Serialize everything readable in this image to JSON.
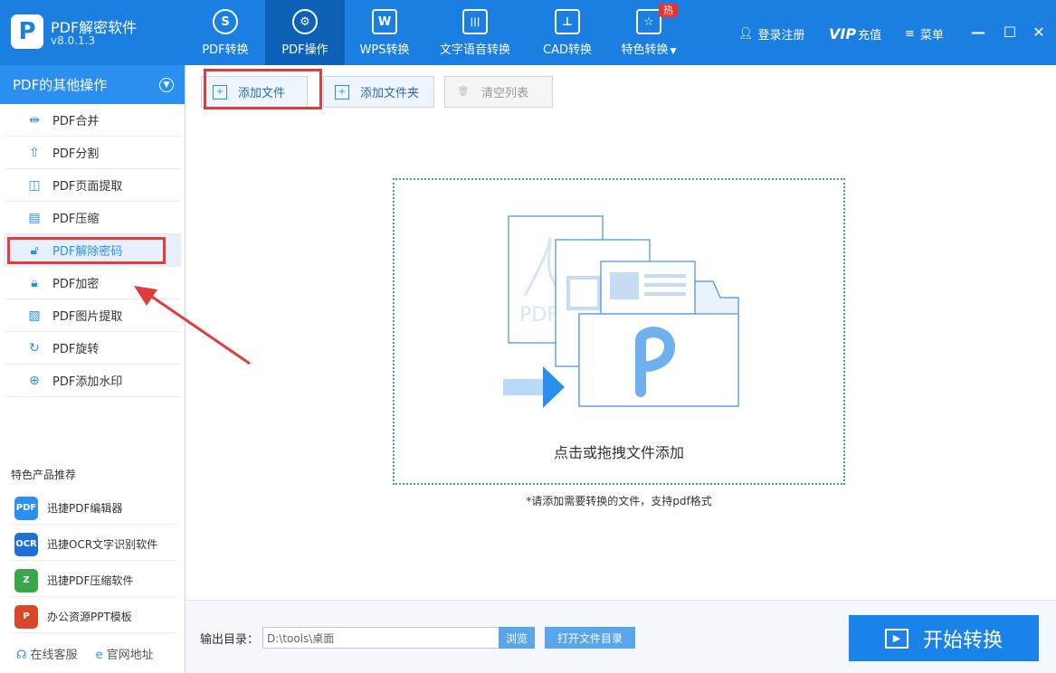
{
  "app": {
    "name": "PDF解密软件",
    "version": "v8.0.1.3",
    "logo_letter": "P"
  },
  "nav": [
    {
      "label": "PDF转换",
      "icon": "S",
      "active": false
    },
    {
      "label": "PDF操作",
      "icon": "⚙",
      "active": true
    },
    {
      "label": "WPS转换",
      "icon": "W",
      "active": false
    },
    {
      "label": "文字语音转换",
      "icon": "|||",
      "active": false
    },
    {
      "label": "CAD转换",
      "icon": "⊥",
      "active": false
    },
    {
      "label": "特色转换",
      "icon": "☆",
      "active": false,
      "badge": "热"
    }
  ],
  "topright": {
    "login": "登录注册",
    "vip": "VIP",
    "recharge": "充值",
    "menu": "菜单"
  },
  "sidebar": {
    "header": "PDF的其他操作",
    "items": [
      {
        "label": "PDF合并",
        "icon": "merge-icon"
      },
      {
        "label": "PDF分割",
        "icon": "split-icon"
      },
      {
        "label": "PDF页面提取",
        "icon": "extract-icon"
      },
      {
        "label": "PDF压缩",
        "icon": "compress-icon"
      },
      {
        "label": "PDF解除密码",
        "icon": "unlock-icon",
        "active": true
      },
      {
        "label": "PDF加密",
        "icon": "lock-icon"
      },
      {
        "label": "PDF图片提取",
        "icon": "image-icon"
      },
      {
        "label": "PDF旋转",
        "icon": "rotate-icon"
      },
      {
        "label": "PDF添加水印",
        "icon": "watermark-icon"
      }
    ],
    "section_title": "特色产品推荐",
    "promos": [
      {
        "label": "迅捷PDF编辑器",
        "badge": "PDF",
        "color": "#2b8ff0"
      },
      {
        "label": "迅捷OCR文字识别软件",
        "badge": "OCR",
        "color": "#1f6fd6"
      },
      {
        "label": "迅捷PDF压缩软件",
        "badge": "Z",
        "color": "#3aa54a"
      },
      {
        "label": "办公资源PPT模板",
        "badge": "P",
        "color": "#d9472b"
      }
    ],
    "footer": {
      "service": "在线客服",
      "website": "官网地址"
    }
  },
  "toolbar": {
    "add_file": "添加文件",
    "add_folder": "添加文件夹",
    "clear_list": "清空列表"
  },
  "dropzone": {
    "text": "点击或拖拽文件添加",
    "hint": "*请添加需要转换的文件，支持pdf格式",
    "doc_watermark": "PDF"
  },
  "output": {
    "label": "输出目录：",
    "path": "D:\\tools\\桌面",
    "browse": "浏览",
    "open_dir": "打开文件目录",
    "start": "开始转换"
  },
  "colors": {
    "primary": "#1a7fe0",
    "accent": "#2b8ff0",
    "highlight": "#e23b3b"
  }
}
